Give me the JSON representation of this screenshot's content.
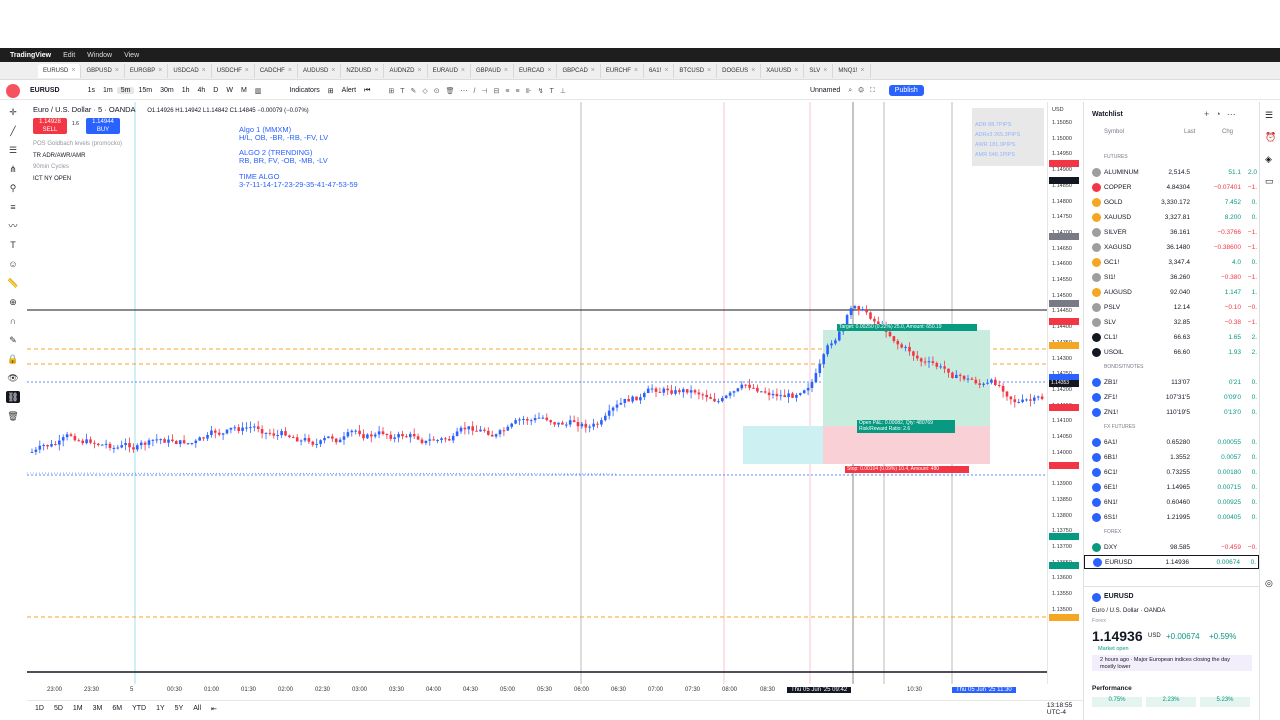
{
  "menubar": {
    "app": "TradingView",
    "items": [
      "Edit",
      "Window",
      "View"
    ]
  },
  "tabs": [
    "EURUSD",
    "GBPUSD",
    "EURGBP",
    "USDCAD",
    "USDCHF",
    "CADCHF",
    "AUDUSD",
    "NZDUSD",
    "AUDNZD",
    "EURAUD",
    "GBPAUD",
    "EURCAD",
    "GBPCAD",
    "EURCHF",
    "6A1!",
    "BTCUSD",
    "DOGEUS",
    "XAUUSD",
    "SLV",
    "MNQ1!"
  ],
  "toolbar": {
    "symbol": "EURUSD",
    "intervals": [
      "1s",
      "1m",
      "5m",
      "15m",
      "30m",
      "1h",
      "4h",
      "D",
      "W",
      "M"
    ],
    "indicators": "Indicators",
    "alert": "Alert",
    "layout": "Unnamed",
    "publish": "Publish"
  },
  "legend": {
    "title": "Euro / U.S. Dollar · 5 · OANDA",
    "ohlc": "O1.14926 H1.14942 L1.14842 C1.14845 −0.00079 (−0.07%)",
    "sell_price": "1.14928",
    "sell": "SELL",
    "buy_price": "1.14944",
    "buy": "BUY",
    "spread": "1.6",
    "indicators": [
      "POS Goldbach levels (promocko)",
      "90min Cycles",
      "TR ADR/AWR/AMR",
      "ICT NY OPEN"
    ]
  },
  "algo": {
    "a1": "Algo 1 (MMXM)",
    "a1b": "H/L, OB, -BR, -RB, -FV, LV",
    "a2": "ALGO 2 (TRENDING)",
    "a2b": "RB, BR, FV, -OB, -MB, -LV",
    "a3": "TIME ALGO",
    "a3b": "3-7-11-14-17-23-29-35-41-47-53-59"
  },
  "adr": {
    "r1": "ADR   88.7PIPS",
    "r2": "ADRx3  265.3PIPS",
    "r3": "AWR   181.9PIPS",
    "r4": "AMR   546.1PIPS"
  },
  "position": {
    "target": "Target: 0.00250 (0.22%) 25.0, Amount: 650.19",
    "open": "Open P&L: 0.00082, Qty: 480769",
    "rr": "Risk/Reward Ratio: 2.6",
    "stop": "Stop: 0.00104 (0.09%) 10.4, Amount: 480"
  },
  "price_scale": {
    "currency": "USD",
    "labels": [
      "1.15050",
      "1.15000",
      "1.14950",
      "1.14900",
      "1.14850",
      "1.14800",
      "1.14750",
      "1.14700",
      "1.14650",
      "1.14600",
      "1.14550",
      "1.14500",
      "1.14450",
      "1.14400",
      "1.14350",
      "1.14300",
      "1.14250",
      "1.14200",
      "1.14150",
      "1.14100",
      "1.14050",
      "1.14000",
      "1.13950",
      "1.13900",
      "1.13850",
      "1.13800",
      "1.13750",
      "1.13700",
      "1.13650",
      "1.13600",
      "1.13550",
      "1.13500"
    ],
    "current": "1.14353"
  },
  "time_axis": [
    "23:00",
    "23:30",
    "5",
    "00:30",
    "01:00",
    "01:30",
    "02:00",
    "02:30",
    "03:00",
    "03:30",
    "04:00",
    "04:30",
    "05:00",
    "05:30",
    "06:00",
    "06:30",
    "07:00",
    "07:30",
    "08:00",
    "08:30",
    "Thu 05 Jun '25  09:42",
    "10:30",
    "Thu 05 Jun '25  11:30"
  ],
  "bottom": {
    "ranges": [
      "1D",
      "5D",
      "1M",
      "3M",
      "6M",
      "YTD",
      "1Y",
      "5Y",
      "All"
    ],
    "clock": "13:18:55 UTC-4"
  },
  "watchlist": {
    "title": "Watchlist",
    "cols": [
      "Symbol",
      "Last",
      "Chg",
      "Chg%"
    ],
    "sections": [
      {
        "name": "FUTURES",
        "rows": [
          [
            "ALUMINUM",
            "2,514.5",
            "51.1",
            "2.0"
          ],
          [
            "COPPER",
            "4.84304",
            "−0.07401",
            "−1."
          ],
          [
            "GOLD",
            "3,330.172",
            "7.452",
            "0."
          ],
          [
            "XAUUSD",
            "3,327.81",
            "8.200",
            "0."
          ],
          [
            "SILVER",
            "36.161",
            "−0.3766",
            "−1."
          ],
          [
            "XAGUSD",
            "36.1480",
            "−0.38600",
            "−1."
          ],
          [
            "GC1!",
            "3,347.4",
            "4.0",
            "0."
          ],
          [
            "SI1!",
            "36.260",
            "−0.380",
            "−1."
          ],
          [
            "AUGUSD",
            "92.040",
            "1.147",
            "1."
          ],
          [
            "PSLV",
            "12.14",
            "−0.10",
            "−0."
          ],
          [
            "SLV",
            "32.85",
            "−0.38",
            "−1."
          ],
          [
            "CL1!",
            "66.63",
            "1.65",
            "2."
          ],
          [
            "USOIL",
            "66.60",
            "1.93",
            "2."
          ]
        ]
      },
      {
        "name": "BONDS/TNOTES",
        "rows": [
          [
            "ZB1!",
            "113'07",
            "0'21",
            "0."
          ],
          [
            "ZF1!",
            "107'31'5",
            "0'09'0",
            "0."
          ],
          [
            "ZN1!",
            "110'19'5",
            "0'13'0",
            "0."
          ]
        ]
      },
      {
        "name": "FX FUTURES",
        "rows": [
          [
            "6A1!",
            "0.65280",
            "0.00055",
            "0."
          ],
          [
            "6B1!",
            "1.3552",
            "0.0057",
            "0."
          ],
          [
            "6C1!",
            "0.73255",
            "0.00180",
            "0."
          ],
          [
            "6E1!",
            "1.14965",
            "0.00715",
            "0."
          ],
          [
            "6N1!",
            "0.60460",
            "0.00925",
            "0."
          ],
          [
            "6S1!",
            "1.21995",
            "0.00405",
            "0."
          ]
        ]
      },
      {
        "name": "FOREX",
        "rows": [
          [
            "DXY",
            "98.585",
            "−0.459",
            "−0."
          ],
          [
            "EURUSD",
            "1.14936",
            "0.00674",
            "0."
          ]
        ]
      }
    ]
  },
  "detail": {
    "symbol": "EURUSD",
    "name": "Euro / U.S. Dollar",
    "exch": "OANDA",
    "type": "Forex",
    "price": "1.14936",
    "cur": "USD",
    "chg": "+0.00674",
    "pct": "+0.59%",
    "status": "Market open",
    "news": "2 hours ago · Major European indices closing the day mostly lower",
    "perf": "Performance",
    "p1": "0.75%",
    "p2": "2.23%",
    "p3": "5.23%"
  }
}
